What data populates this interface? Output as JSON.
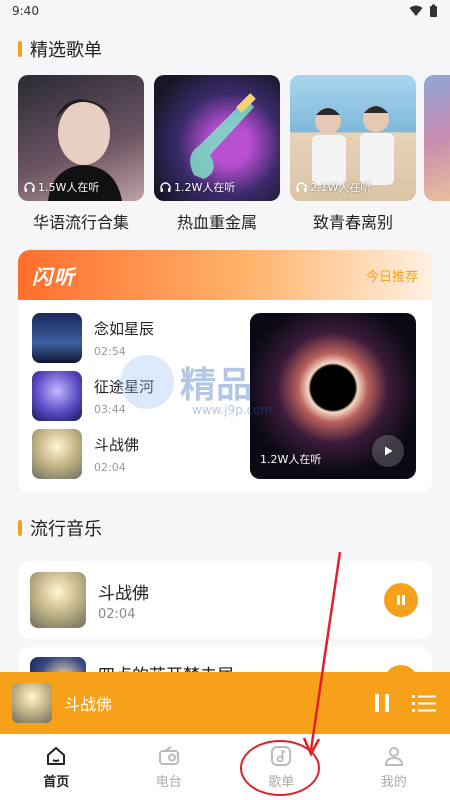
{
  "status": {
    "time": "9:40"
  },
  "sections": {
    "featured_title": "精选歌单",
    "popular_title": "流行音乐"
  },
  "playlists": [
    {
      "name": "华语流行合集",
      "listeners": "1.5W人在听",
      "colors": [
        "#3b3b44",
        "#8a6b74"
      ]
    },
    {
      "name": "热血重金属",
      "listeners": "1.2W人在听",
      "colors": [
        "#1b1b2a",
        "#7b3fa0"
      ]
    },
    {
      "name": "致青春离别",
      "listeners": "2.1W人在听",
      "colors": [
        "#7fb9d9",
        "#e7d3b8"
      ]
    }
  ],
  "flash": {
    "logo": "闪听",
    "tag": "今日推荐",
    "songs": [
      {
        "title": "念如星辰",
        "time": "02:54"
      },
      {
        "title": "征途星河",
        "time": "03:44"
      },
      {
        "title": "斗战佛",
        "time": "02:04"
      }
    ],
    "feature_listeners": "1.2W人在听"
  },
  "watermark": {
    "text": "精品",
    "url": "www.j9p.com"
  },
  "popular": [
    {
      "title": "斗战佛",
      "time": "02:04"
    },
    {
      "title": "四点的花开梦未居",
      "time": ""
    }
  ],
  "mini_player": {
    "title": "斗战佛"
  },
  "tabs": [
    {
      "label": "首页",
      "icon": "home-icon",
      "active": true
    },
    {
      "label": "电台",
      "icon": "radio-icon",
      "active": false
    },
    {
      "label": "歌单",
      "icon": "playlist-icon",
      "active": false
    },
    {
      "label": "我的",
      "icon": "profile-icon",
      "active": false
    }
  ],
  "colors": {
    "accent": "#f7a11b",
    "annotation": "#e0202a"
  }
}
